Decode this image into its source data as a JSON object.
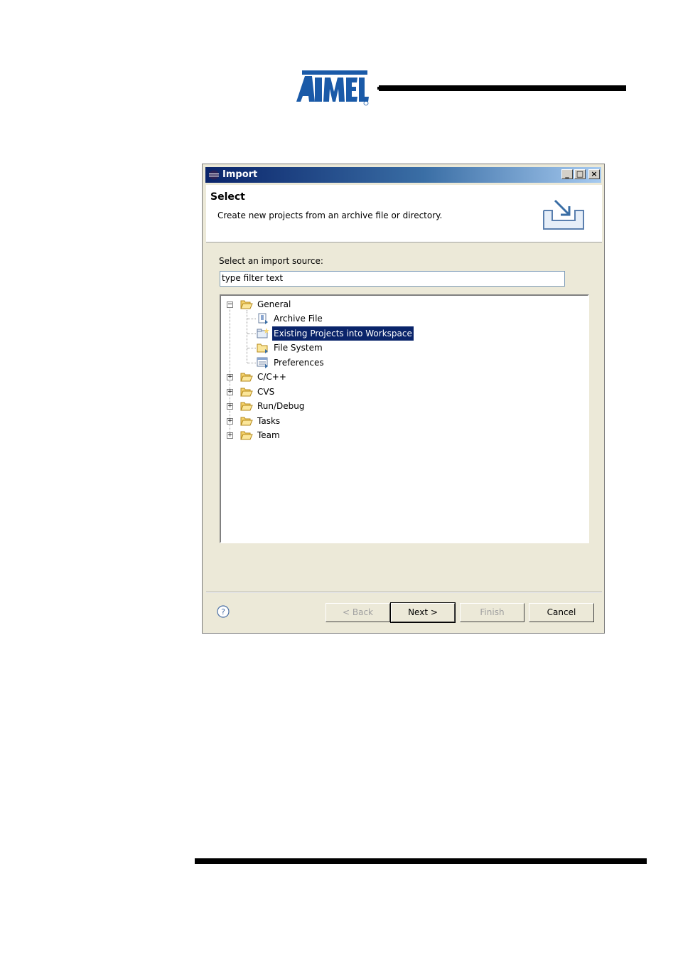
{
  "logo": {
    "text": "ATMEL"
  },
  "dialog": {
    "title": "Import",
    "window_buttons": {
      "minimize": "_",
      "maximize": "□",
      "close": "×"
    },
    "header": {
      "title": "Select",
      "description": "Create new projects from an archive file or directory."
    },
    "filter_label": "Select an import source:",
    "filter_value": "type filter text",
    "tree": {
      "general": "General",
      "general_children": [
        "Archive File",
        "Existing Projects into Workspace",
        "File System",
        "Preferences"
      ],
      "selected": "Existing Projects into Workspace",
      "collapsed": [
        "C/C++",
        "CVS",
        "Run/Debug",
        "Tasks",
        "Team"
      ]
    },
    "buttons": {
      "back": "< Back",
      "next": "Next >",
      "finish": "Finish",
      "cancel": "Cancel"
    }
  }
}
